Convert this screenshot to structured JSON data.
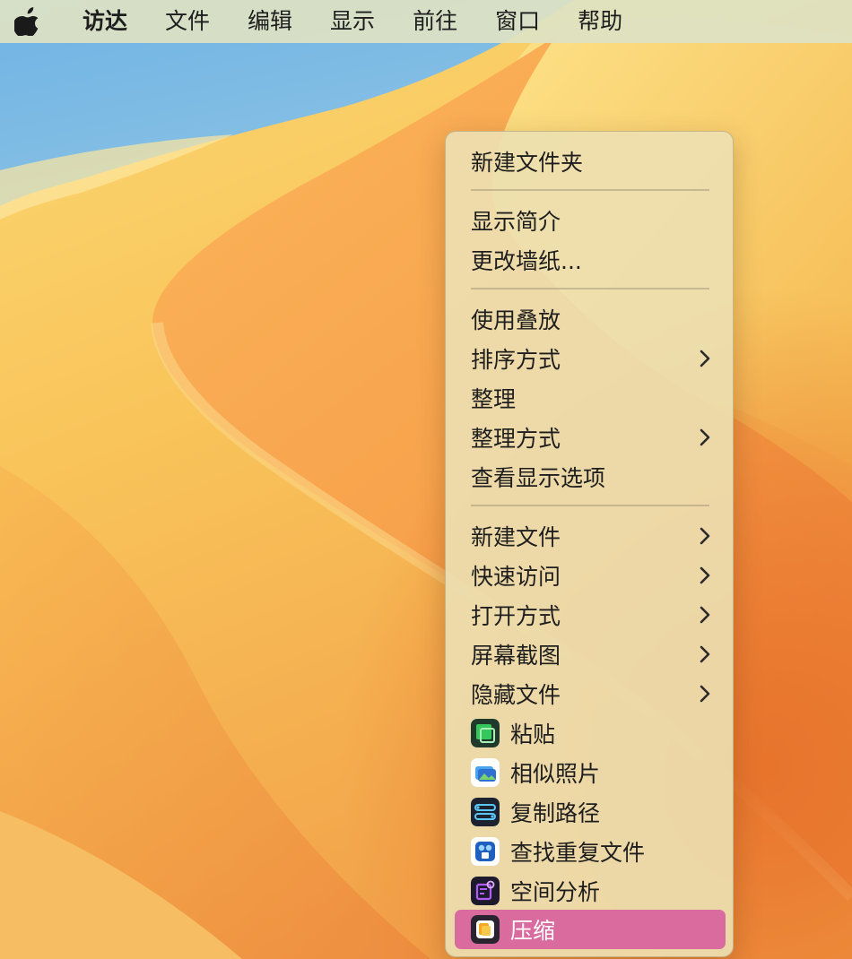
{
  "menubar": {
    "items": [
      "访达",
      "文件",
      "编辑",
      "显示",
      "前往",
      "窗口",
      "帮助"
    ]
  },
  "context_menu": {
    "items": [
      {
        "label": "新建文件夹"
      },
      {
        "label": "显示简介"
      },
      {
        "label": "更改墙纸..."
      },
      {
        "label": "使用叠放"
      },
      {
        "label": "排序方式",
        "submenu": true
      },
      {
        "label": "整理"
      },
      {
        "label": "整理方式",
        "submenu": true
      },
      {
        "label": "查看显示选项"
      },
      {
        "label": "新建文件",
        "submenu": true
      },
      {
        "label": "快速访问",
        "submenu": true
      },
      {
        "label": "打开方式",
        "submenu": true
      },
      {
        "label": "屏幕截图",
        "submenu": true
      },
      {
        "label": "隐藏文件",
        "submenu": true
      },
      {
        "label": "粘贴",
        "icon": "paste-app-icon"
      },
      {
        "label": "相似照片",
        "icon": "similar-photos-app-icon"
      },
      {
        "label": "复制路径",
        "icon": "copy-path-app-icon"
      },
      {
        "label": "查找重复文件",
        "icon": "duplicate-finder-app-icon"
      },
      {
        "label": "空间分析",
        "icon": "space-analyzer-app-icon"
      },
      {
        "label": "压缩",
        "icon": "compress-app-icon",
        "highlighted": true
      }
    ]
  },
  "colors": {
    "highlight": "#d96b9f",
    "menubar": "#dee2c4",
    "wallpaper_sky": "#7ab9e4",
    "wallpaper_orange": "#f0a048"
  }
}
